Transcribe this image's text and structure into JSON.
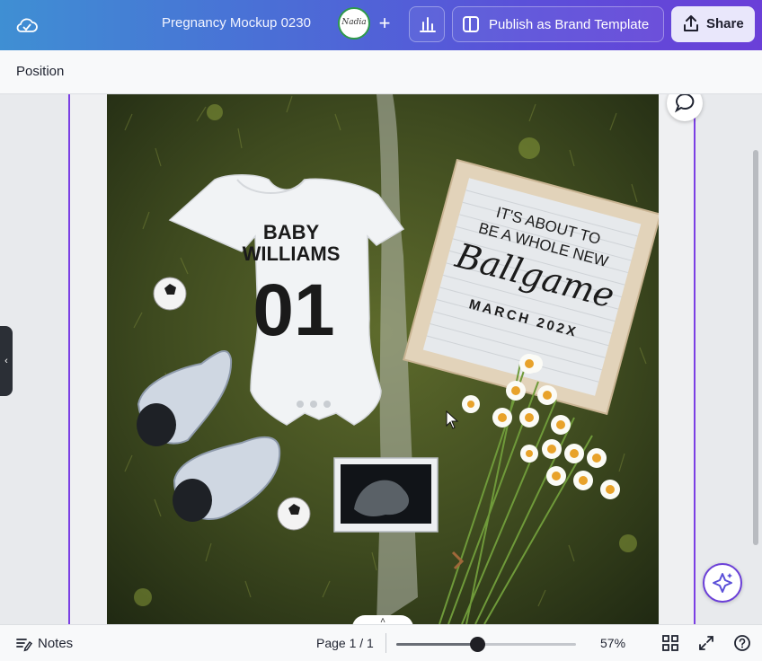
{
  "header": {
    "doc_title": "Pregnancy Mockup 0230",
    "avatar_text": "Nadia",
    "plus_label": "+",
    "publish_label": "Publish as Brand Template",
    "share_label": "Share"
  },
  "context_toolbar": {
    "position_label": "Position"
  },
  "canvas": {
    "onesie_line1": "BABY",
    "onesie_line2": "WILLIAMS",
    "onesie_number": "01",
    "board_line1": "IT'S ABOUT TO",
    "board_line2": "BE A WHOLE NEW",
    "board_script": "Ballgame",
    "board_date": "MARCH 202X",
    "side_tab_glyph": "‹",
    "collapse_glyph": "˄"
  },
  "footer": {
    "notes_label": "Notes",
    "page_indicator": "Page 1 / 1",
    "zoom_value": "57%",
    "zoom_fraction": 0.45
  },
  "colors": {
    "accent": "#7b3fe4",
    "header_start": "#3f8fd3",
    "header_end": "#6a3fd8"
  }
}
